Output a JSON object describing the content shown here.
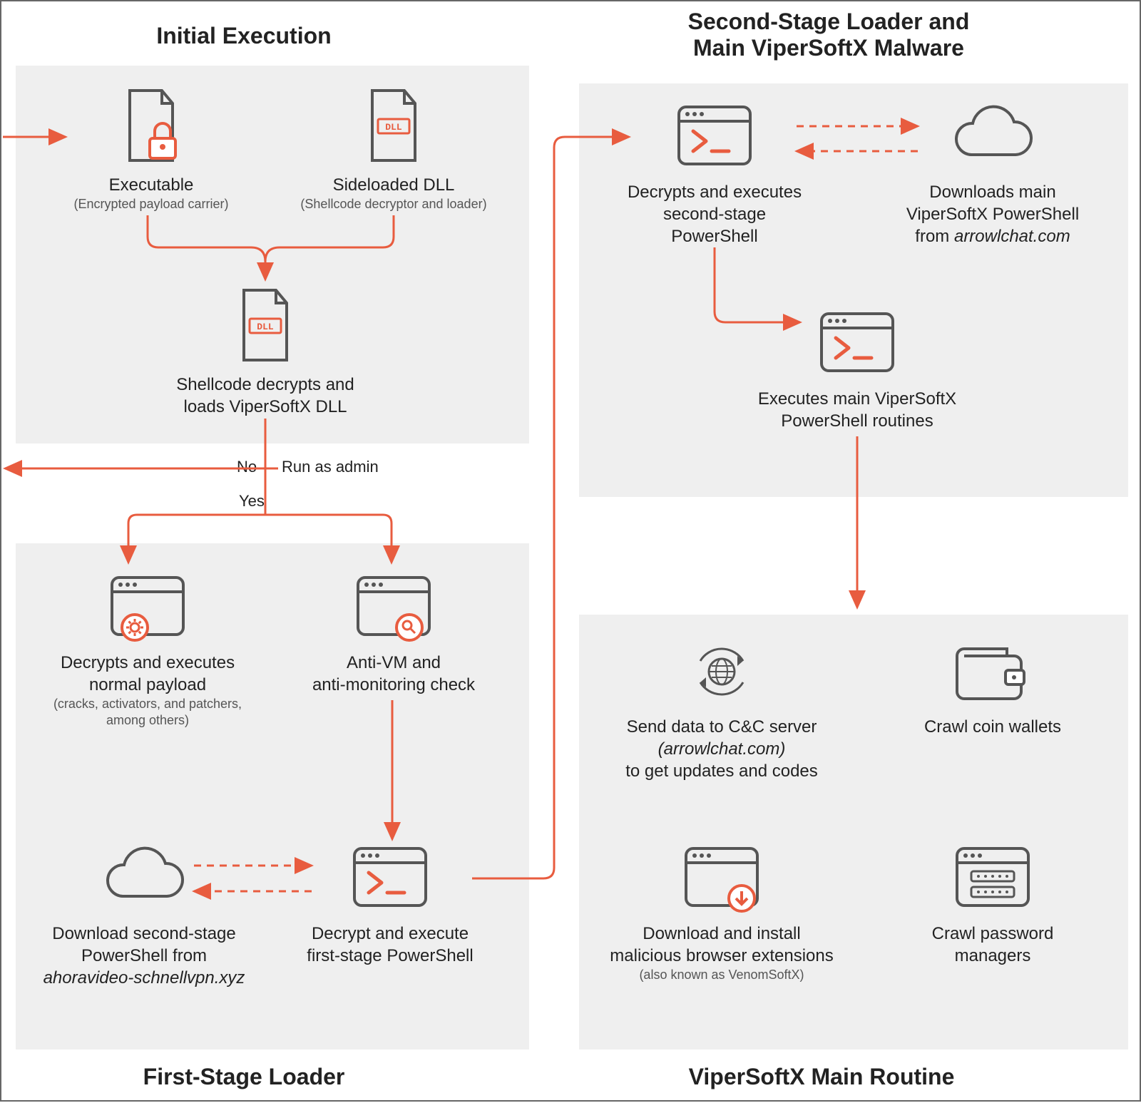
{
  "colors": {
    "accent": "#E85C3F",
    "stroke": "#555",
    "panel": "#efefef"
  },
  "titles": {
    "initial": "Initial Execution",
    "secondStage": "Second-Stage Loader and\nMain ViperSoftX Malware",
    "firstStage": "First-Stage Loader",
    "mainRoutine": "ViperSoftX Main Routine"
  },
  "nodes": {
    "exe": {
      "title": "Executable",
      "sub": "(Encrypted payload carrier)"
    },
    "dll": {
      "title": "Sideloaded DLL",
      "sub": "(Shellcode decryptor and loader)"
    },
    "shellcode": {
      "title": "Shellcode decrypts and\nloads ViperSoftX DLL"
    },
    "admin": {
      "label": "Run as admin",
      "yes": "Yes",
      "no": "No"
    },
    "normalPayload": {
      "title": "Decrypts and executes\nnormal payload",
      "sub": "(cracks, activators, and patchers,\namong others)"
    },
    "antiVM": {
      "title": "Anti-VM and\nanti-monitoring check"
    },
    "downloadStage2": {
      "title": "Download second-stage\nPowerShell from",
      "italic": "ahoravideo-schnellvpn.xyz"
    },
    "decryptStage1": {
      "title": "Decrypt and execute\nfirst-stage PowerShell"
    },
    "decryptStage2": {
      "title": "Decrypts and executes\nsecond-stage\nPowerShell"
    },
    "downloadMain": {
      "title": "Downloads main\nViperSoftX PowerShell\nfrom ",
      "italic": "arrowlchat.com"
    },
    "execMain": {
      "title": "Executes main ViperSoftX\nPowerShell routines"
    },
    "sendCC": {
      "title": "Send data to C&C server",
      "italic": "(arrowlchat.com)",
      "title2": "to get updates and codes"
    },
    "crawlWallets": {
      "title": "Crawl coin wallets"
    },
    "downloadExt": {
      "title": "Download and install\nmalicious browser extensions",
      "sub": "(also known as VenomSoftX)"
    },
    "crawlPwd": {
      "title": "Crawl password\nmanagers"
    }
  }
}
